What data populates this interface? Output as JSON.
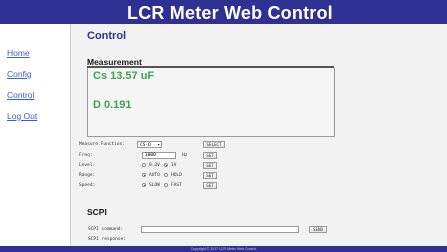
{
  "header": {
    "title": "LCR Meter Web Control"
  },
  "sidebar": {
    "items": [
      {
        "label": "Home"
      },
      {
        "label": "Config"
      },
      {
        "label": "Control"
      },
      {
        "label": "Log Out"
      }
    ]
  },
  "main": {
    "title": "Control",
    "measurement": {
      "heading": "Measurement",
      "primary": "Cs 13.57 uF",
      "secondary": "D 0.191"
    },
    "form": {
      "measure_function_label": "Measure Function:",
      "measure_function_value": "CS-D",
      "select_button": "SELECT",
      "freq_label": "Freq:",
      "freq_value": "1000",
      "freq_unit": "Hz",
      "set_button": "SET",
      "level_label": "Level:",
      "level_options": [
        "0.3V",
        "1V"
      ],
      "level_selected": "1V",
      "range_label": "Range:",
      "range_options": [
        "AUTO",
        "HOLD"
      ],
      "range_selected": "AUTO",
      "speed_label": "Speed:",
      "speed_options": [
        "SLOW",
        "FAST"
      ],
      "speed_selected": "SLOW"
    },
    "scpi": {
      "heading": "SCPI",
      "command_label": "SCPI command:",
      "command_value": "",
      "send_button": "SEND",
      "response_label": "SCPI response:"
    }
  },
  "footer": {
    "text": "Copyright © 2017 LCR Meter Web Control"
  },
  "colors": {
    "banner": "#2e3192",
    "value": "#3aa24a",
    "link": "#3a5fcd",
    "content_bg": "#f2f2f2"
  }
}
